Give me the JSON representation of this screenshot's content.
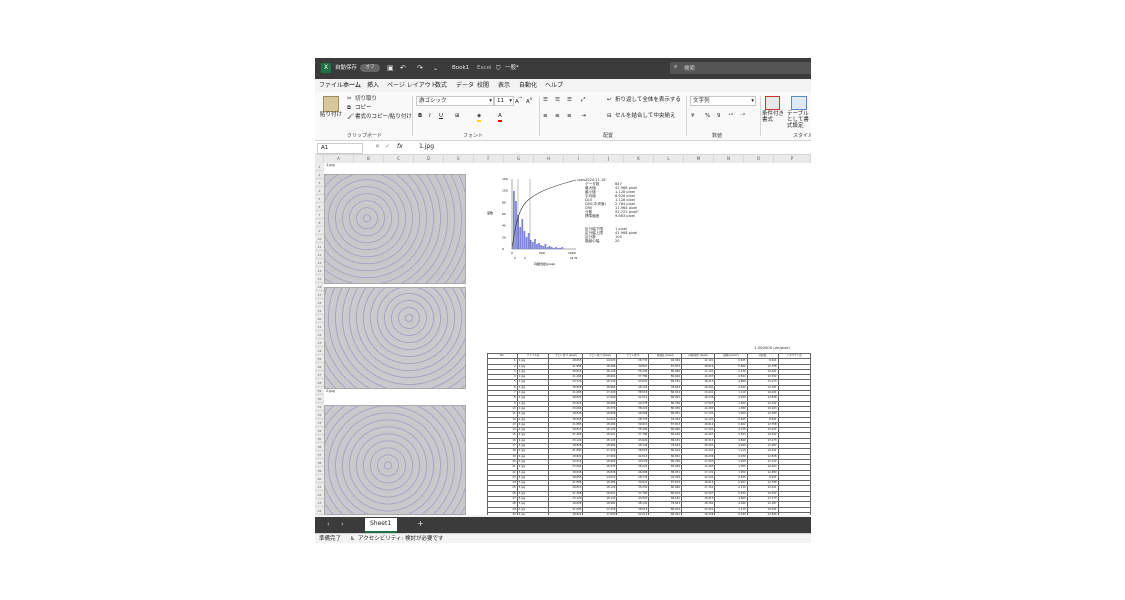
{
  "titlebar": {
    "autosave_label": "自動保存",
    "autosave_state": "オフ",
    "filename": "Book1",
    "app": "Excel",
    "sensitivity": "一般*",
    "search_placeholder": "検索"
  },
  "menu": [
    "ファイル",
    "ホーム",
    "挿入",
    "ページ レイアウト",
    "数式",
    "データ",
    "校閲",
    "表示",
    "自動化",
    "ヘルプ"
  ],
  "ribbon": {
    "paste": "貼り付け",
    "cut": "切り取り",
    "copy": "コピー",
    "format_painter": "書式のコピー/貼り付け",
    "group_clipboard": "クリップボード",
    "font_name": "游ゴシック",
    "font_size": "11",
    "group_font": "フォント",
    "wrap_text": "折り返して全体を表示する",
    "merge_center": "セルを結合して中央揃え",
    "group_alignment": "配置",
    "number_format": "文字列",
    "group_number": "数値",
    "cond_format": "条件付き書式",
    "table_format": "テーブルとして書式設定",
    "group_style": "スタイル"
  },
  "formula": {
    "name_box": "A1",
    "fx": "fx",
    "value": "1.jpg"
  },
  "columns": [
    "A",
    "B",
    "C",
    "D",
    "E",
    "F",
    "G",
    "H",
    "I",
    "J",
    "K",
    "L",
    "M",
    "N",
    "O",
    "P"
  ],
  "sheet": {
    "a1": "1.jpg",
    "img_label_2": "2.jpg",
    "img_label_3": "3.jpg",
    "scale_label": "1.000000 μm/pixel"
  },
  "histogram": {
    "y_ticks": [
      "120",
      "100",
      "80",
      "60",
      "40",
      "20",
      "0"
    ],
    "x_ticks": [
      "0",
      "500",
      "1000"
    ],
    "x_sub": [
      "0",
      "4",
      "41.3k"
    ],
    "xlabel": "円相当径(pixel)",
    "pct_label": "100%",
    "ylabel": "度数"
  },
  "stats": {
    "date": "2024.11.18",
    "rows": [
      [
        "データ数",
        "847"
      ],
      [
        "最大値",
        "41.988 pixel"
      ],
      [
        "最小値",
        "1.128 pixel"
      ],
      [
        "平均値",
        "6.626 pixel"
      ],
      [
        "D10",
        "1.128 pixel"
      ],
      [
        "D50(中央値)",
        "2.764 pixel"
      ],
      [
        "D90",
        "11.964 pixel"
      ],
      [
        "分散",
        "92.722 pixel²"
      ],
      [
        "標準偏差",
        "9.863 pixel"
      ]
    ],
    "rows2": [
      [
        "区分幅下限",
        "1 pixel"
      ],
      [
        "区分幅上限",
        "41.988 pixel"
      ],
      [
        "区分数",
        "100"
      ],
      [
        "階級の幅",
        "20"
      ]
    ]
  },
  "table": {
    "headers": [
      "No.",
      "ファイル名",
      "フェレ径 X (pixel)",
      "フェレ径 Y (pixel)",
      "フェレ径 D",
      "周囲長 (pixel)",
      "円相当径 (pixel)",
      "面積 (pixel²)",
      "円形度",
      "アスペクト比"
    ],
    "rows": [
      [
        "1",
        "1.jpg",
        "18.655",
        "14.023",
        "28.733",
        "94.394",
        "12.101",
        "0.635",
        "8.641"
      ],
      [
        "2",
        "1.jpg",
        "21.885",
        "18.284",
        "39.821",
        "87.813",
        "18.614",
        "0.902",
        "12.798"
      ],
      [
        "3",
        "1.jpg",
        "29.813",
        "18.129",
        "35.230",
        "80.066",
        "17.101",
        "2.130",
        "12.441"
      ],
      [
        "4",
        "1.jpg",
        "21.466",
        "18.601",
        "37.786",
        "80.044",
        "14.207",
        "0.594",
        "10.332"
      ],
      [
        "5",
        "1.jpg",
        "23.120",
        "18.143",
        "43.620",
        "89.181",
        "18.313",
        "4.860",
        "13.173"
      ],
      [
        "6",
        "1.jpg",
        "18.828",
        "18.984",
        "48.144",
        "78.643",
        "18.181",
        "4.040",
        "12.187"
      ],
      [
        "7",
        "1.jpg",
        "21.083",
        "17.429",
        "38.518",
        "86.914",
        "13.441",
        "1.119",
        "10.441"
      ],
      [
        "8",
        "1.jpg",
        "18.822",
        "17.600",
        "42.014",
        "86.091",
        "16.236",
        "0.039",
        "12.848"
      ],
      [
        "9",
        "1.jpg",
        "23.616",
        "18.960",
        "42.078",
        "86.766",
        "17.563",
        "1.200",
        "12.132"
      ],
      [
        "10",
        "1.jpg",
        "23.064",
        "18.376",
        "38.224",
        "80.056",
        "14.183",
        "1.380",
        "10.263"
      ],
      [
        "11",
        "2.jpg",
        "18.848",
        "18.848",
        "46.898",
        "88.951",
        "17.131",
        "1.950",
        "12.380"
      ],
      [
        "12",
        "2.jpg",
        "18.655",
        "14.023",
        "28.733",
        "94.394",
        "12.101",
        "0.635",
        "8.641"
      ],
      [
        "13",
        "2.jpg",
        "21.885",
        "18.284",
        "39.821",
        "87.813",
        "18.614",
        "0.902",
        "12.798"
      ],
      [
        "14",
        "2.jpg",
        "29.813",
        "18.129",
        "35.230",
        "80.066",
        "17.101",
        "2.130",
        "12.441"
      ],
      [
        "15",
        "2.jpg",
        "21.466",
        "18.601",
        "37.786",
        "80.044",
        "14.207",
        "0.594",
        "10.332"
      ],
      [
        "16",
        "2.jpg",
        "23.120",
        "18.143",
        "43.620",
        "89.181",
        "18.313",
        "4.860",
        "13.173"
      ],
      [
        "17",
        "2.jpg",
        "18.828",
        "18.984",
        "48.144",
        "78.643",
        "18.181",
        "4.040",
        "12.187"
      ],
      [
        "18",
        "2.jpg",
        "21.083",
        "17.429",
        "38.518",
        "86.914",
        "13.441",
        "1.119",
        "10.441"
      ],
      [
        "19",
        "2.jpg",
        "18.822",
        "17.600",
        "42.014",
        "86.091",
        "16.236",
        "0.039",
        "12.848"
      ],
      [
        "20",
        "2.jpg",
        "23.616",
        "18.960",
        "42.078",
        "86.766",
        "17.563",
        "1.200",
        "12.132"
      ],
      [
        "21",
        "2.jpg",
        "23.064",
        "18.376",
        "38.224",
        "80.056",
        "14.183",
        "1.380",
        "10.263"
      ],
      [
        "22",
        "3.jpg",
        "18.848",
        "18.848",
        "46.898",
        "88.951",
        "17.131",
        "1.950",
        "12.380"
      ],
      [
        "23",
        "3.jpg",
        "18.655",
        "14.023",
        "28.733",
        "94.394",
        "12.101",
        "0.635",
        "8.641"
      ],
      [
        "24",
        "3.jpg",
        "21.885",
        "18.284",
        "39.821",
        "87.813",
        "18.614",
        "0.902",
        "12.798"
      ],
      [
        "25",
        "3.jpg",
        "29.813",
        "18.129",
        "35.230",
        "80.066",
        "17.101",
        "2.130",
        "12.441"
      ],
      [
        "26",
        "3.jpg",
        "21.466",
        "18.601",
        "37.786",
        "80.044",
        "14.207",
        "0.594",
        "10.332"
      ],
      [
        "27",
        "3.jpg",
        "23.120",
        "18.143",
        "43.620",
        "89.181",
        "18.313",
        "4.860",
        "13.173"
      ],
      [
        "28",
        "3.jpg",
        "18.828",
        "18.984",
        "48.144",
        "78.643",
        "18.181",
        "4.040",
        "12.187"
      ],
      [
        "29",
        "3.jpg",
        "21.083",
        "17.429",
        "38.518",
        "86.914",
        "13.441",
        "1.119",
        "10.441"
      ],
      [
        "30",
        "3.jpg",
        "18.822",
        "17.600",
        "42.014",
        "86.091",
        "16.236",
        "0.039",
        "12.848"
      ],
      [
        "31",
        "3.jpg",
        "23.616",
        "18.960",
        "42.078",
        "86.766",
        "17.563",
        "1.200",
        "12.132"
      ],
      [
        "32",
        "4.jpg",
        "23.064",
        "18.376",
        "38.224",
        "80.056",
        "14.183",
        "1.380",
        "10.263"
      ],
      [
        "33",
        "4.jpg",
        "18.848",
        "18.848",
        "46.898",
        "88.951",
        "17.131",
        "1.950",
        "12.380"
      ],
      [
        "34",
        "4.jpg",
        "18.655",
        "14.023",
        "28.733",
        "94.394",
        "12.101",
        "0.635",
        "8.641"
      ],
      [
        "35",
        "4.jpg",
        "21.885",
        "18.284",
        "39.821",
        "87.813",
        "18.614",
        "0.902",
        "12.798"
      ]
    ]
  },
  "tabs": {
    "sheet": "Sheet1",
    "add": "+"
  },
  "status": {
    "ready": "準備完了",
    "accessibility": "アクセシビリティ: 検討が必要です"
  }
}
